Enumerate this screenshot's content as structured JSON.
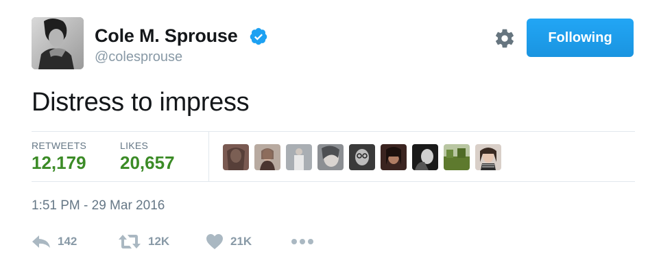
{
  "user": {
    "display_name": "Cole M. Sprouse",
    "handle": "@colesprouse",
    "verified": true
  },
  "header": {
    "settings_icon": "gear-icon",
    "follow_button_label": "Following"
  },
  "tweet": {
    "text": "Distress to impress",
    "timestamp": "1:51 PM - 29 Mar 2016"
  },
  "stats": {
    "retweets_label": "RETWEETS",
    "retweets_value": "12,179",
    "likes_label": "LIKES",
    "likes_value": "20,657"
  },
  "actions": {
    "reply_count": "142",
    "retweet_count": "12K",
    "like_count": "21K"
  },
  "colors": {
    "accent": "#1da1f2",
    "stat_value": "#3b8b26",
    "muted": "#8899a6"
  }
}
